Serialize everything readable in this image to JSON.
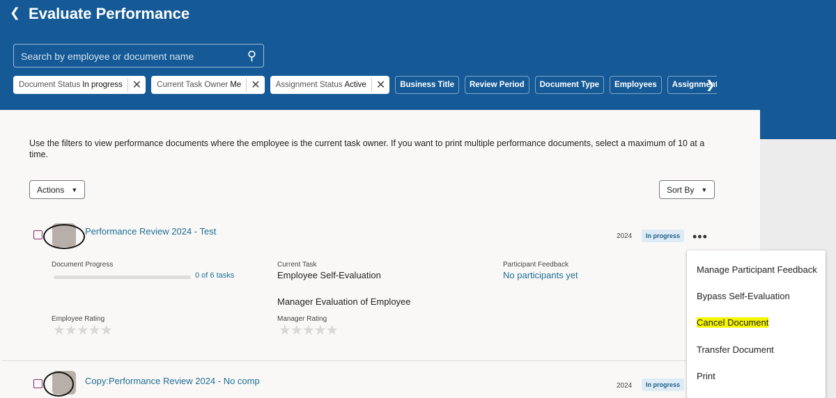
{
  "header": {
    "title": "Evaluate Performance",
    "search_placeholder": "Search by employee or document name"
  },
  "filters": {
    "selected": [
      {
        "label": "Document Status",
        "value": "In progress"
      },
      {
        "label": "Current Task Owner",
        "value": "Me"
      },
      {
        "label": "Assignment Status",
        "value": "Active"
      }
    ],
    "unselected": [
      "Business Title",
      "Review Period",
      "Document Type",
      "Employees",
      "Assignment Type"
    ]
  },
  "description": "Use the filters to view performance documents where the employee is the current task owner. If you want to print multiple performance documents, select a maximum of 10 at a time.",
  "toolbar": {
    "actions": "Actions",
    "sort": "Sort By"
  },
  "documents": [
    {
      "title": "Performance Review 2024 - Test",
      "year": "2024",
      "status": "In progress",
      "progress_label": "Document Progress",
      "progress_text": "0 of 6 tasks",
      "progress": 0,
      "current_task_label": "Current Task",
      "tasks": [
        "Employee Self-Evaluation",
        "Manager Evaluation of Employee"
      ],
      "feedback_label": "Participant Feedback",
      "feedback": "No participants yet",
      "employee_rating_label": "Employee Rating",
      "manager_rating_label": "Manager Rating",
      "employee_rating": 0,
      "manager_rating": 0
    },
    {
      "title": "Copy:Performance Review 2024 - No comp",
      "year": "2024",
      "status": "In progress"
    }
  ],
  "menu": [
    "Manage Participant Feedback",
    "Bypass Self-Evaluation",
    "Cancel Document",
    "Transfer Document",
    "Print"
  ]
}
